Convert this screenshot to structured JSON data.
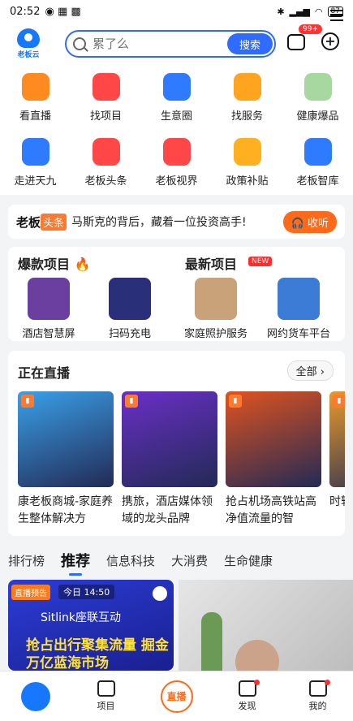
{
  "status": {
    "time": "02:52",
    "battery": "87"
  },
  "header": {
    "logo_text": "老板云",
    "search_placeholder": "累了么",
    "search_button": "搜索",
    "msg_badge": "99+"
  },
  "grid": [
    {
      "label": "看直播",
      "icon": "play-icon",
      "color": "#ff8a1f"
    },
    {
      "label": "找项目",
      "icon": "search-doc-icon",
      "color": "#ff4747"
    },
    {
      "label": "生意圈",
      "icon": "chat-bubble-icon",
      "color": "#2f7bff"
    },
    {
      "label": "找服务",
      "icon": "heart-icon",
      "color": "#ffa41f"
    },
    {
      "label": "健康爆品",
      "icon": "k-badge-icon",
      "color": "#a6d8a0"
    },
    {
      "label": "走进天九",
      "icon": "bird-icon",
      "color": "#2f7bff"
    },
    {
      "label": "老板头条",
      "icon": "news-icon",
      "color": "#ff4747"
    },
    {
      "label": "老板视界",
      "icon": "video-icon",
      "color": "#ff4747"
    },
    {
      "label": "政策补贴",
      "icon": "subsidy-icon",
      "color": "#ffb020"
    },
    {
      "label": "老板智库",
      "icon": "stack-icon",
      "color": "#2f7bff"
    }
  ],
  "news": {
    "brand": "老板",
    "brand_hl": "头条",
    "title": "马斯克的背后，藏着一位投资高手!",
    "collect": "收听"
  },
  "projects": {
    "hot_title": "爆款项目",
    "new_title": "最新项目",
    "new_badge": "NEW",
    "items": [
      {
        "label": "酒店智慧屏",
        "color": "#6b3fa0"
      },
      {
        "label": "扫码充电",
        "color": "#2a2f7a"
      },
      {
        "label": "家庭照护服务",
        "color": "#c9a27a"
      },
      {
        "label": "网约货车平台",
        "color": "#3c7bd6"
      }
    ]
  },
  "live": {
    "title": "正在直播",
    "all": "全部",
    "cards": [
      {
        "caption": "康老板商城-家庭养生整体解决方",
        "color": "#3aa0e8"
      },
      {
        "caption": "携旅，酒店媒体领域的龙头品牌",
        "color": "#6a2fc7"
      },
      {
        "caption": "抢占机场高铁站高净值流量的智",
        "color": "#e0531f"
      },
      {
        "caption": "时轻",
        "color": "#e89a2a"
      }
    ]
  },
  "tabs": [
    "排行榜",
    "推荐",
    "信息科技",
    "大消费",
    "生命健康"
  ],
  "active_tab": 1,
  "feed": {
    "tag": "直播预告",
    "time": "今日 14:50",
    "brand": "Sitlink座联互动",
    "headline": "抢占出行聚集流量 掘金万亿蓝海市场"
  },
  "nav": [
    {
      "label": "",
      "icon": "home-logo-icon"
    },
    {
      "label": "项目",
      "icon": "folder-icon"
    },
    {
      "label": "直播",
      "icon": "live-icon"
    },
    {
      "label": "发现",
      "icon": "compass-icon"
    },
    {
      "label": "我的",
      "icon": "profile-icon"
    }
  ]
}
